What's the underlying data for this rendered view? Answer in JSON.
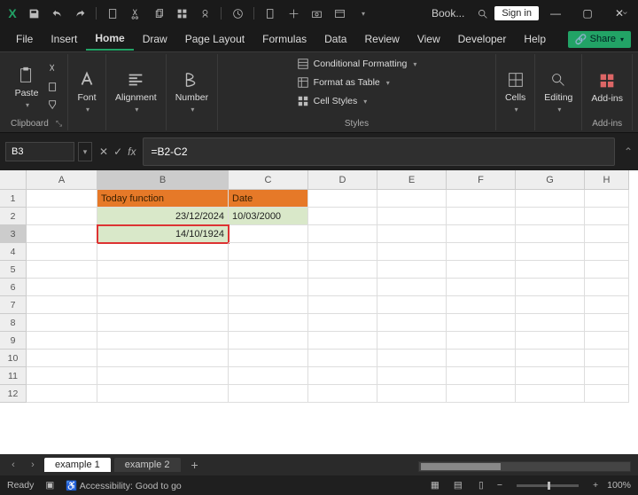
{
  "titlebar": {
    "book_label": "Book...",
    "signin": "Sign in"
  },
  "tabs": [
    "File",
    "Insert",
    "Home",
    "Draw",
    "Page Layout",
    "Formulas",
    "Data",
    "Review",
    "View",
    "Developer",
    "Help"
  ],
  "active_tab": 2,
  "share_label": "Share",
  "ribbon": {
    "clipboard": {
      "paste": "Paste",
      "label": "Clipboard"
    },
    "font": {
      "label": "Font"
    },
    "alignment": {
      "label": "Alignment"
    },
    "number": {
      "label": "Number"
    },
    "styles": {
      "cond_format": "Conditional Formatting",
      "format_table": "Format as Table",
      "cell_styles": "Cell Styles",
      "label": "Styles"
    },
    "cells": {
      "label": "Cells"
    },
    "editing": {
      "label": "Editing"
    },
    "addins": {
      "label": "Add-ins"
    }
  },
  "name_box": "B3",
  "formula": "=B2-C2",
  "columns": [
    "A",
    "B",
    "C",
    "D",
    "E",
    "F",
    "G",
    "H"
  ],
  "rows": [
    1,
    2,
    3,
    4,
    5,
    6,
    7,
    8,
    9,
    10,
    11,
    12
  ],
  "cells": {
    "B1": "Today function",
    "C1": "Date",
    "B2": "23/12/2024",
    "C2": "10/03/2000",
    "B3": "14/10/1924"
  },
  "sheets": {
    "active": "example 1",
    "other": "example 2"
  },
  "status": {
    "ready": "Ready",
    "access": "Accessibility: Good to go",
    "zoom": "100%"
  }
}
